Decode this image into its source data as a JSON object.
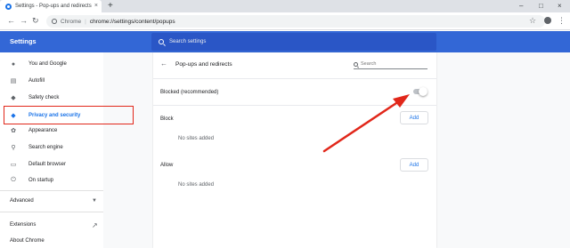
{
  "browser": {
    "tab_title": "Settings - Pop-ups and redirects",
    "tab_close": "×",
    "new_tab": "+",
    "window_controls": [
      "–",
      "□",
      "×"
    ],
    "omnibox": {
      "scheme_label": "Chrome",
      "separator": "|",
      "url": "chrome://settings/content/popups"
    }
  },
  "header": {
    "title": "Settings",
    "search_placeholder": "Search settings"
  },
  "sidebar": {
    "items": [
      {
        "label": "You and Google",
        "icon": "person-icon"
      },
      {
        "label": "Autofill",
        "icon": "clipboard-icon"
      },
      {
        "label": "Safety check",
        "icon": "shield-icon"
      },
      {
        "label": "Privacy and security",
        "icon": "shield-lock-icon",
        "active": true
      },
      {
        "label": "Appearance",
        "icon": "palette-icon"
      },
      {
        "label": "Search engine",
        "icon": "search-icon"
      },
      {
        "label": "Default browser",
        "icon": "browser-icon"
      },
      {
        "label": "On startup",
        "icon": "power-icon"
      }
    ],
    "advanced_label": "Advanced",
    "extensions_label": "Extensions",
    "about_label": "About Chrome"
  },
  "page": {
    "title": "Pop-ups and redirects",
    "search_placeholder": "Search",
    "blocked_label": "Blocked (recommended)",
    "blocked_enabled": false,
    "block_section": {
      "heading": "Block",
      "add_label": "Add",
      "empty_text": "No sites added"
    },
    "allow_section": {
      "heading": "Allow",
      "add_label": "Add",
      "empty_text": "No sites added"
    }
  },
  "annotation": {
    "highlight_color": "#e1271a",
    "arrow_color": "#e1271a"
  },
  "colors": {
    "header_bg": "#3367d6",
    "accent": "#1a73e8"
  }
}
